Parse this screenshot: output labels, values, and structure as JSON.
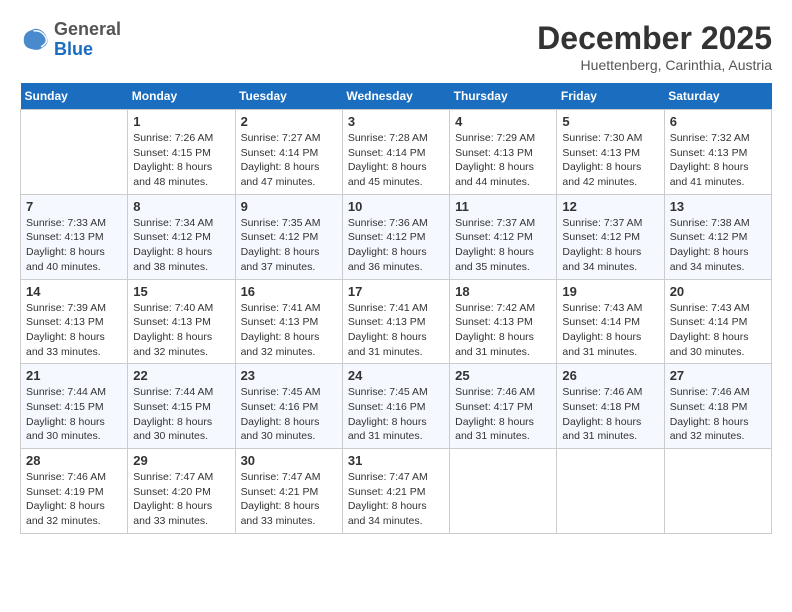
{
  "header": {
    "logo": {
      "general": "General",
      "blue": "Blue"
    },
    "title": "December 2025",
    "location": "Huettenberg, Carinthia, Austria"
  },
  "weekdays": [
    "Sunday",
    "Monday",
    "Tuesday",
    "Wednesday",
    "Thursday",
    "Friday",
    "Saturday"
  ],
  "weeks": [
    [
      {
        "day": "",
        "info": ""
      },
      {
        "day": "1",
        "info": "Sunrise: 7:26 AM\nSunset: 4:15 PM\nDaylight: 8 hours\nand 48 minutes."
      },
      {
        "day": "2",
        "info": "Sunrise: 7:27 AM\nSunset: 4:14 PM\nDaylight: 8 hours\nand 47 minutes."
      },
      {
        "day": "3",
        "info": "Sunrise: 7:28 AM\nSunset: 4:14 PM\nDaylight: 8 hours\nand 45 minutes."
      },
      {
        "day": "4",
        "info": "Sunrise: 7:29 AM\nSunset: 4:13 PM\nDaylight: 8 hours\nand 44 minutes."
      },
      {
        "day": "5",
        "info": "Sunrise: 7:30 AM\nSunset: 4:13 PM\nDaylight: 8 hours\nand 42 minutes."
      },
      {
        "day": "6",
        "info": "Sunrise: 7:32 AM\nSunset: 4:13 PM\nDaylight: 8 hours\nand 41 minutes."
      }
    ],
    [
      {
        "day": "7",
        "info": "Sunrise: 7:33 AM\nSunset: 4:13 PM\nDaylight: 8 hours\nand 40 minutes."
      },
      {
        "day": "8",
        "info": "Sunrise: 7:34 AM\nSunset: 4:12 PM\nDaylight: 8 hours\nand 38 minutes."
      },
      {
        "day": "9",
        "info": "Sunrise: 7:35 AM\nSunset: 4:12 PM\nDaylight: 8 hours\nand 37 minutes."
      },
      {
        "day": "10",
        "info": "Sunrise: 7:36 AM\nSunset: 4:12 PM\nDaylight: 8 hours\nand 36 minutes."
      },
      {
        "day": "11",
        "info": "Sunrise: 7:37 AM\nSunset: 4:12 PM\nDaylight: 8 hours\nand 35 minutes."
      },
      {
        "day": "12",
        "info": "Sunrise: 7:37 AM\nSunset: 4:12 PM\nDaylight: 8 hours\nand 34 minutes."
      },
      {
        "day": "13",
        "info": "Sunrise: 7:38 AM\nSunset: 4:12 PM\nDaylight: 8 hours\nand 34 minutes."
      }
    ],
    [
      {
        "day": "14",
        "info": "Sunrise: 7:39 AM\nSunset: 4:13 PM\nDaylight: 8 hours\nand 33 minutes."
      },
      {
        "day": "15",
        "info": "Sunrise: 7:40 AM\nSunset: 4:13 PM\nDaylight: 8 hours\nand 32 minutes."
      },
      {
        "day": "16",
        "info": "Sunrise: 7:41 AM\nSunset: 4:13 PM\nDaylight: 8 hours\nand 32 minutes."
      },
      {
        "day": "17",
        "info": "Sunrise: 7:41 AM\nSunset: 4:13 PM\nDaylight: 8 hours\nand 31 minutes."
      },
      {
        "day": "18",
        "info": "Sunrise: 7:42 AM\nSunset: 4:13 PM\nDaylight: 8 hours\nand 31 minutes."
      },
      {
        "day": "19",
        "info": "Sunrise: 7:43 AM\nSunset: 4:14 PM\nDaylight: 8 hours\nand 31 minutes."
      },
      {
        "day": "20",
        "info": "Sunrise: 7:43 AM\nSunset: 4:14 PM\nDaylight: 8 hours\nand 30 minutes."
      }
    ],
    [
      {
        "day": "21",
        "info": "Sunrise: 7:44 AM\nSunset: 4:15 PM\nDaylight: 8 hours\nand 30 minutes."
      },
      {
        "day": "22",
        "info": "Sunrise: 7:44 AM\nSunset: 4:15 PM\nDaylight: 8 hours\nand 30 minutes."
      },
      {
        "day": "23",
        "info": "Sunrise: 7:45 AM\nSunset: 4:16 PM\nDaylight: 8 hours\nand 30 minutes."
      },
      {
        "day": "24",
        "info": "Sunrise: 7:45 AM\nSunset: 4:16 PM\nDaylight: 8 hours\nand 31 minutes."
      },
      {
        "day": "25",
        "info": "Sunrise: 7:46 AM\nSunset: 4:17 PM\nDaylight: 8 hours\nand 31 minutes."
      },
      {
        "day": "26",
        "info": "Sunrise: 7:46 AM\nSunset: 4:18 PM\nDaylight: 8 hours\nand 31 minutes."
      },
      {
        "day": "27",
        "info": "Sunrise: 7:46 AM\nSunset: 4:18 PM\nDaylight: 8 hours\nand 32 minutes."
      }
    ],
    [
      {
        "day": "28",
        "info": "Sunrise: 7:46 AM\nSunset: 4:19 PM\nDaylight: 8 hours\nand 32 minutes."
      },
      {
        "day": "29",
        "info": "Sunrise: 7:47 AM\nSunset: 4:20 PM\nDaylight: 8 hours\nand 33 minutes."
      },
      {
        "day": "30",
        "info": "Sunrise: 7:47 AM\nSunset: 4:21 PM\nDaylight: 8 hours\nand 33 minutes."
      },
      {
        "day": "31",
        "info": "Sunrise: 7:47 AM\nSunset: 4:21 PM\nDaylight: 8 hours\nand 34 minutes."
      },
      {
        "day": "",
        "info": ""
      },
      {
        "day": "",
        "info": ""
      },
      {
        "day": "",
        "info": ""
      }
    ]
  ]
}
